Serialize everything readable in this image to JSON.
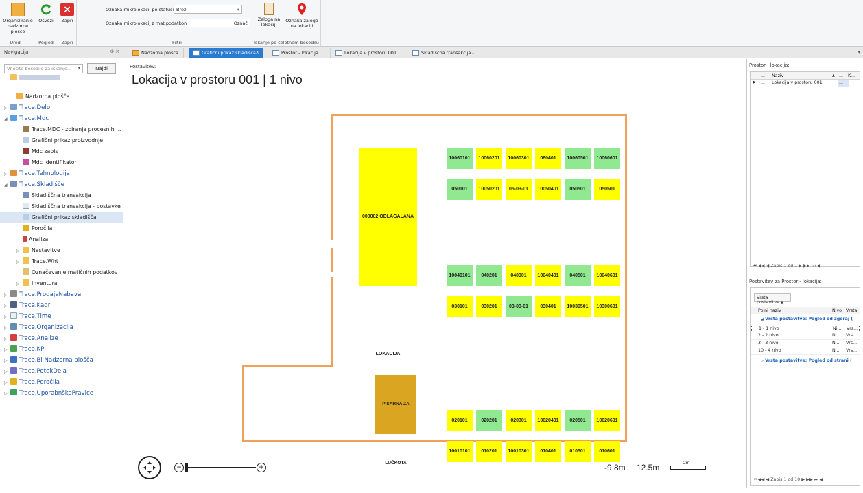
{
  "ribbon": {
    "groups": {
      "uredi": "Uredi",
      "pogled": "Pogled",
      "zapri": "Zapri",
      "filtri": "Filtri",
      "iskanje": "Iskanje po celotnem besedilu"
    },
    "buttons": {
      "organize": "Organiziranje nadzorne plošče",
      "refresh": "Osveži",
      "close": "Zapri",
      "stock_at_location": "Zaloga na lokaciji",
      "mark_stock": "Oznaka zaloga na lokaciji"
    },
    "filters": {
      "status_label": "Oznaka mikrolokacij po statusu",
      "status_value": "Brez",
      "mat_label": "Oznaka mikrolokacij z mat.podatkom",
      "mat_value": "",
      "mark_button": "Označ"
    }
  },
  "nav": {
    "header": "Navigacija",
    "search_placeholder": "Vnesite besedilo za iskanje...",
    "find_button": "Najdi",
    "items": [
      {
        "label": "Nadzorna plošča"
      },
      {
        "label": "Trace.Delo"
      },
      {
        "label": "Trace.Mdc"
      },
      {
        "label": "Trace.MDC - zbiranja procesnih ..."
      },
      {
        "label": "Grafični prikaz proizvodnje"
      },
      {
        "label": "Mdc zapis"
      },
      {
        "label": "Mdc Identifikator"
      },
      {
        "label": "Trace.Tehnologija"
      },
      {
        "label": "Trace.Skladišče"
      },
      {
        "label": "Skladiščna transakcija"
      },
      {
        "label": "Skladiščna transakcija - postavke"
      },
      {
        "label": "Grafični prikaz skladišča"
      },
      {
        "label": "Poročila"
      },
      {
        "label": "Analiza"
      },
      {
        "label": "Nastavitve"
      },
      {
        "label": "Trace.Wht"
      },
      {
        "label": "Označevanje matičnih podatkov"
      },
      {
        "label": "Inventura"
      },
      {
        "label": "Trace.ProdajaNabava"
      },
      {
        "label": "Trace.Kadri"
      },
      {
        "label": "Trace.Time"
      },
      {
        "label": "Trace.Organizacija"
      },
      {
        "label": "Trace.Analize"
      },
      {
        "label": "Trace.KPI"
      },
      {
        "label": "Trace.Bi Nadzorna plošča"
      },
      {
        "label": "Trace.PotekDela"
      },
      {
        "label": "Trace.Poročila"
      },
      {
        "label": "Trace.UporabnškePravice"
      }
    ]
  },
  "tabs": [
    {
      "label": "Nadzorna plošča"
    },
    {
      "label": "Grafični prikaz skladišča"
    },
    {
      "label": "Prostor - lokacija"
    },
    {
      "label": "Lokacija v prostoru 001"
    },
    {
      "label": "Skladiščna transakcija -"
    }
  ],
  "canvas": {
    "label": "Postavitev:",
    "title": "Lokacija v prostoru 001 | 1 nivo",
    "big_block_1": "000002 ODLAGALANA LOKACIJA",
    "big_block_2": "PISARNA ZA LUČKOTA",
    "rows": [
      [
        "10060101",
        "10060201",
        "10060301",
        "060401",
        "10060501",
        "10060601"
      ],
      [
        "050101",
        "10050201",
        "05-03-01",
        "10050401",
        "050501",
        "050501"
      ],
      [
        "10040101",
        "040201",
        "040301",
        "10040401",
        "040501",
        "10040601"
      ],
      [
        "030101",
        "030201",
        "03-03-01",
        "030401",
        "10030501",
        "10300601"
      ],
      [
        "020101",
        "020201",
        "020301",
        "10020401",
        "020501",
        "10020601"
      ],
      [
        "10010101",
        "010201",
        "10010301",
        "010401",
        "010501",
        "010601"
      ]
    ],
    "row_colors": [
      [
        "#90e890",
        "#ffff00",
        "#ffff00",
        "#ffff00",
        "#90e890",
        "#90e890"
      ],
      [
        "#90e890",
        "#ffff00",
        "#ffff00",
        "#ffff00",
        "#90e890",
        "#ffff00"
      ],
      [
        "#90e890",
        "#90e890",
        "#ffff00",
        "#ffff00",
        "#90e890",
        "#ffff00"
      ],
      [
        "#ffff00",
        "#ffff00",
        "#90e890",
        "#ffff00",
        "#ffff00",
        "#ffff00"
      ],
      [
        "#ffff00",
        "#90e890",
        "#ffff00",
        "#ffff00",
        "#90e890",
        "#ffff00"
      ],
      [
        "#ffff00",
        "#ffff00",
        "#ffff00",
        "#ffff00",
        "#ffff00",
        "#ffff00"
      ]
    ],
    "coord_x": "-9.8m",
    "coord_y": "12.5m",
    "scale": "2m"
  },
  "right": {
    "panel1_label": "Prostor - lokacija:",
    "col_naziv": "Naziv",
    "col_k": "K...",
    "row1_value": "Lokacija v prostoru 001",
    "row1_ellipsis": "...",
    "pager1": "Zapis 1 od 1",
    "panel2_label": "Postavitev za Prostor - lokacija:",
    "group_button": "Vrsta postavitve",
    "col_polni": "Polni naziv",
    "col_nivo": "Nivo",
    "col_vrsta": "Vrsta",
    "group1": "Vrsta postavitve: Pogled od zgoraj (",
    "group2": "Vrsta postavitve: Pogled od strani (",
    "rows2": [
      {
        "name": "1 - 1 nivo",
        "nivo": "Ni...",
        "vrsta": "Vrs..."
      },
      {
        "name": "2 - 2 nivo",
        "nivo": "Ni...",
        "vrsta": "Vrs..."
      },
      {
        "name": "3 - 3 nivo",
        "nivo": "Ni...",
        "vrsta": "Vrs..."
      },
      {
        "name": "10 - 4 nivo",
        "nivo": "Ni...",
        "vrsta": "Vrs..."
      }
    ],
    "pager2": "Zapis 1 od 10"
  }
}
